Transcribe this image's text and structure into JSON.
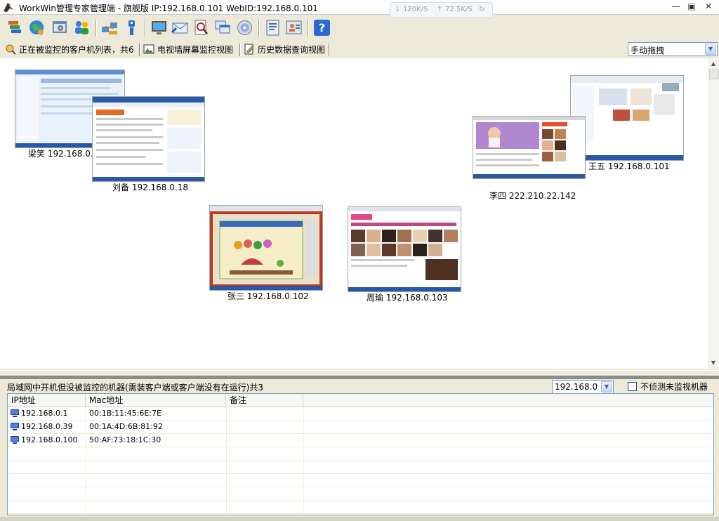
{
  "window": {
    "title": "WorkWin管理专家管理端 - 旗舰版 IP:192.168.0.101 WebID:192.168.0.101",
    "upload_speed": "120K/S",
    "download_speed": "72.5K/S"
  },
  "toolbar": {
    "buttons": [
      "stack-icon",
      "globe-icon",
      "settings-window-icon",
      "users-icon",
      "network-icon",
      "info-icon",
      "monitor-icon",
      "mail-icon",
      "document-search-icon",
      "windows-icon",
      "disc-icon",
      "report-icon",
      "user-card-icon",
      "help-icon"
    ]
  },
  "tabs": [
    {
      "label": "正在被监控的客户机列表，共6"
    },
    {
      "label": "电视墙屏幕监控视图"
    },
    {
      "label": "历史数据查询视图"
    }
  ],
  "arrange_mode": {
    "value": "手动拖拽"
  },
  "clients": [
    {
      "name": "梁笑 192.168.0."
    },
    {
      "name": "刘备 192.168.0.18"
    },
    {
      "name": "李四 222.210.22.142"
    },
    {
      "name": "王五 192.168.0.101"
    },
    {
      "name": "张三 192.168.0.102"
    },
    {
      "name": "周瑜 192.168.0.103"
    }
  ],
  "lower_panel": {
    "title": "局域网中开机但没被监控的机器(需装客户端或客户端没有在运行)共3",
    "subnet": "192.168.0",
    "checkbox_label": "不侦测未监视机器",
    "columns": [
      "IP地址",
      "Mac地址",
      "备注"
    ],
    "rows": [
      {
        "ip": "192.168.0.1",
        "mac": "00:1B:11:45:6E:7E",
        "note": ""
      },
      {
        "ip": "192.168.0.39",
        "mac": "00:1A:4D:6B:81:92",
        "note": ""
      },
      {
        "ip": "192.168.0.100",
        "mac": "50:AF:73:18:1C:30",
        "note": ""
      }
    ]
  }
}
